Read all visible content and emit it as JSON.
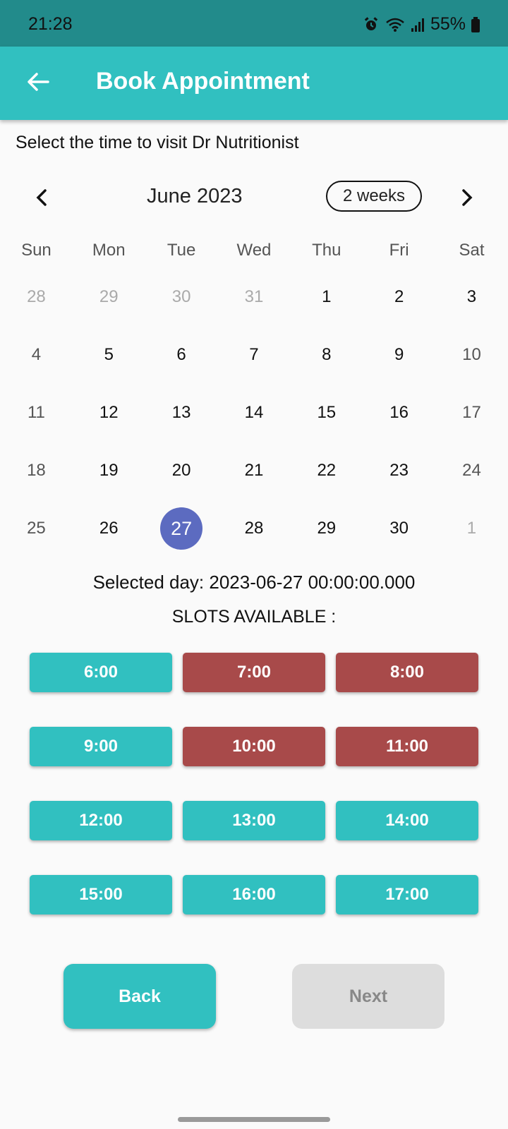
{
  "status_bar": {
    "time": "21:28",
    "battery": "55%",
    "icons": [
      "alarm-icon",
      "wifi-icon",
      "signal-icon",
      "battery-icon"
    ]
  },
  "app_bar": {
    "title": "Book Appointment",
    "back_icon": "arrow-left-icon"
  },
  "prompt": "Select the time to visit Dr Nutritionist",
  "calendar": {
    "month_label": "June 2023",
    "format_button": "2 weeks",
    "weekdays": [
      "Sun",
      "Mon",
      "Tue",
      "Wed",
      "Thu",
      "Fri",
      "Sat"
    ],
    "weeks": [
      [
        {
          "d": "28",
          "o": true
        },
        {
          "d": "29",
          "o": true
        },
        {
          "d": "30",
          "o": true
        },
        {
          "d": "31",
          "o": true
        },
        {
          "d": "1"
        },
        {
          "d": "2"
        },
        {
          "d": "3"
        }
      ],
      [
        {
          "d": "4",
          "w": true
        },
        {
          "d": "5"
        },
        {
          "d": "6"
        },
        {
          "d": "7"
        },
        {
          "d": "8"
        },
        {
          "d": "9"
        },
        {
          "d": "10",
          "w": true
        }
      ],
      [
        {
          "d": "11",
          "w": true
        },
        {
          "d": "12"
        },
        {
          "d": "13"
        },
        {
          "d": "14"
        },
        {
          "d": "15"
        },
        {
          "d": "16"
        },
        {
          "d": "17",
          "w": true
        }
      ],
      [
        {
          "d": "18",
          "w": true
        },
        {
          "d": "19"
        },
        {
          "d": "20"
        },
        {
          "d": "21"
        },
        {
          "d": "22"
        },
        {
          "d": "23"
        },
        {
          "d": "24",
          "w": true
        }
      ],
      [
        {
          "d": "25",
          "w": true
        },
        {
          "d": "26"
        },
        {
          "d": "27",
          "s": true
        },
        {
          "d": "28"
        },
        {
          "d": "29"
        },
        {
          "d": "30"
        },
        {
          "d": "1",
          "o": true
        }
      ]
    ],
    "selected_color": "#5c6bc0"
  },
  "selected_day_text": "Selected day: 2023-06-27 00:00:00.000",
  "slots_title": "SLOTS AVAILABLE :",
  "slots": [
    {
      "time": "6:00",
      "status": "available"
    },
    {
      "time": "7:00",
      "status": "booked"
    },
    {
      "time": "8:00",
      "status": "booked"
    },
    {
      "time": "9:00",
      "status": "available"
    },
    {
      "time": "10:00",
      "status": "booked"
    },
    {
      "time": "11:00",
      "status": "booked"
    },
    {
      "time": "12:00",
      "status": "available"
    },
    {
      "time": "13:00",
      "status": "available"
    },
    {
      "time": "14:00",
      "status": "available"
    },
    {
      "time": "15:00",
      "status": "available"
    },
    {
      "time": "16:00",
      "status": "available"
    },
    {
      "time": "17:00",
      "status": "available"
    }
  ],
  "colors": {
    "accent": "#31c0c0",
    "status_bar": "#228b8b",
    "booked": "#a84a4a",
    "disabled": "#dddddd"
  },
  "buttons": {
    "back": "Back",
    "next": "Next",
    "next_enabled": false
  }
}
